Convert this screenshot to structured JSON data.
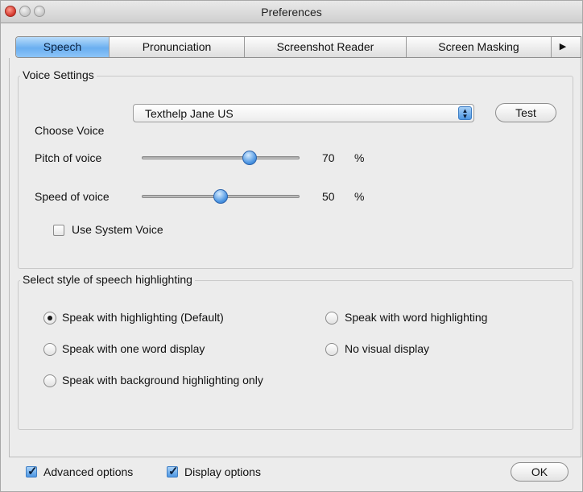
{
  "window": {
    "title": "Preferences"
  },
  "tabs": [
    "Speech",
    "Pronunciation",
    "Screenshot Reader",
    "Screen Masking"
  ],
  "voice_settings": {
    "legend": "Voice Settings",
    "choose_voice_label": "Choose Voice",
    "voice_value": "Texthelp Jane US",
    "test_label": "Test",
    "pitch_label": "Pitch of voice",
    "pitch_value": "70",
    "pitch_percent": 0.7,
    "speed_label": "Speed of voice",
    "speed_value": "50",
    "speed_percent": 0.5,
    "unit": "%",
    "system_voice_label": "Use System Voice",
    "system_voice_checked": false
  },
  "highlighting": {
    "legend": "Select style of speech highlighting",
    "options": [
      {
        "label": "Speak with highlighting (Default)",
        "selected": true
      },
      {
        "label": "Speak with word highlighting",
        "selected": false
      },
      {
        "label": "Speak with one word display",
        "selected": false
      },
      {
        "label": "No visual display",
        "selected": false
      },
      {
        "label": "Speak with background highlighting only",
        "selected": false
      }
    ]
  },
  "footer": {
    "advanced_label": "Advanced options",
    "advanced_checked": true,
    "display_label": "Display options",
    "display_checked": true,
    "ok_label": "OK"
  },
  "colors": {
    "accent": "#5ba3ec",
    "panel": "#ececec"
  }
}
